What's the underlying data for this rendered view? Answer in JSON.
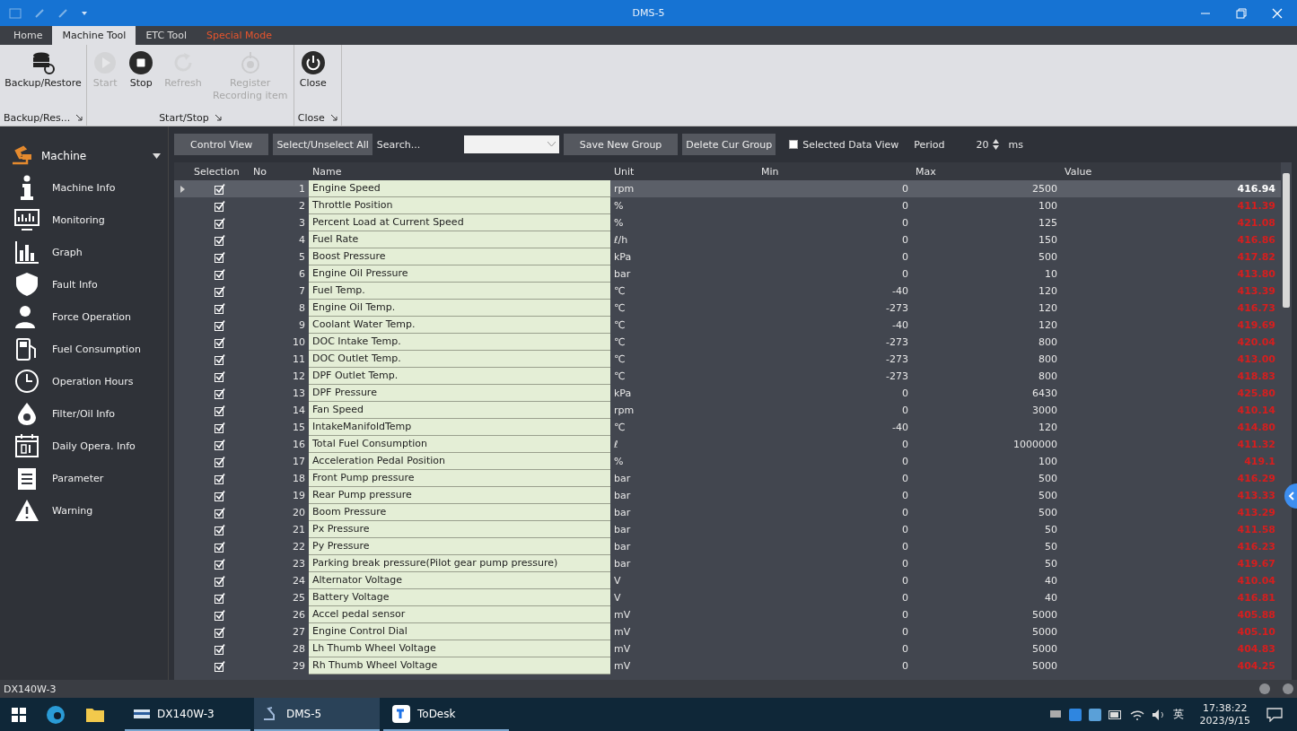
{
  "window": {
    "title": "DMS-5"
  },
  "tabs": [
    {
      "label": "Home",
      "selected": false,
      "kind": "normal"
    },
    {
      "label": "Machine Tool",
      "selected": true,
      "kind": "normal"
    },
    {
      "label": "ETC Tool",
      "selected": false,
      "kind": "normal"
    },
    {
      "label": "Special Mode",
      "selected": false,
      "kind": "special"
    }
  ],
  "ribbon_groups": [
    {
      "name": "Backup/Res...",
      "buttons": [
        {
          "label": "Backup/Restore",
          "disabled": false,
          "kind": "backup"
        }
      ]
    },
    {
      "name": "Start/Stop",
      "buttons": [
        {
          "label": "Start",
          "disabled": true,
          "kind": "start"
        },
        {
          "label": "Stop",
          "disabled": false,
          "kind": "stop"
        },
        {
          "label": "Refresh",
          "disabled": true,
          "kind": "refresh"
        },
        {
          "label": "Register Recording item",
          "disabled": true,
          "kind": "record"
        }
      ]
    },
    {
      "name": "Close",
      "buttons": [
        {
          "label": "Close",
          "disabled": false,
          "kind": "power"
        }
      ]
    }
  ],
  "sidebar": {
    "header": "Machine",
    "items": [
      {
        "label": "Machine Info",
        "kind": "info"
      },
      {
        "label": "Monitoring",
        "kind": "monitor"
      },
      {
        "label": "Graph",
        "kind": "graph"
      },
      {
        "label": "Fault Info",
        "kind": "fault"
      },
      {
        "label": "Force Operation",
        "kind": "person"
      },
      {
        "label": "Fuel Consumption",
        "kind": "fuel"
      },
      {
        "label": "Operation Hours",
        "kind": "clock"
      },
      {
        "label": "Filter/Oil Info",
        "kind": "drop"
      },
      {
        "label": "Daily Opera. Info",
        "kind": "calendar"
      },
      {
        "label": "Parameter",
        "kind": "clipboard"
      },
      {
        "label": "Warning",
        "kind": "warning"
      }
    ]
  },
  "toolbar": {
    "control_view": "Control View",
    "select_all": "Select/Unselect All",
    "search_label": "Search...",
    "save_group": "Save New Group",
    "delete_group": "Delete Cur Group",
    "selected_data_view": {
      "label": "Selected Data View",
      "checked": false
    },
    "period_label": "Period",
    "period_value": "20",
    "period_unit": "ms"
  },
  "table": {
    "columns": [
      "Selection",
      "No",
      "Name",
      "Unit",
      "Min",
      "Max",
      "Value"
    ],
    "rows": [
      {
        "selected": true,
        "checked": true,
        "no": "1",
        "name": "Engine Speed",
        "unit": "rpm",
        "min": "0",
        "max": "2500",
        "value": "416.94"
      },
      {
        "selected": false,
        "checked": true,
        "no": "2",
        "name": "Throttle Position",
        "unit": "%",
        "min": "0",
        "max": "100",
        "value": "411.39"
      },
      {
        "selected": false,
        "checked": true,
        "no": "3",
        "name": "Percent Load at Current Speed",
        "unit": "%",
        "min": "0",
        "max": "125",
        "value": "421.08"
      },
      {
        "selected": false,
        "checked": true,
        "no": "4",
        "name": "Fuel Rate",
        "unit": "ℓ/h",
        "min": "0",
        "max": "150",
        "value": "416.86"
      },
      {
        "selected": false,
        "checked": true,
        "no": "5",
        "name": "Boost Pressure",
        "unit": "kPa",
        "min": "0",
        "max": "500",
        "value": "417.82"
      },
      {
        "selected": false,
        "checked": true,
        "no": "6",
        "name": "Engine Oil Pressure",
        "unit": "bar",
        "min": "0",
        "max": "10",
        "value": "413.80"
      },
      {
        "selected": false,
        "checked": true,
        "no": "7",
        "name": "Fuel Temp.",
        "unit": "℃",
        "min": "-40",
        "max": "120",
        "value": "413.39"
      },
      {
        "selected": false,
        "checked": true,
        "no": "8",
        "name": "Engine Oil Temp.",
        "unit": "℃",
        "min": "-273",
        "max": "120",
        "value": "416.73"
      },
      {
        "selected": false,
        "checked": true,
        "no": "9",
        "name": "Coolant Water Temp.",
        "unit": "℃",
        "min": "-40",
        "max": "120",
        "value": "419.69"
      },
      {
        "selected": false,
        "checked": true,
        "no": "10",
        "name": "DOC Intake Temp.",
        "unit": "℃",
        "min": "-273",
        "max": "800",
        "value": "420.04"
      },
      {
        "selected": false,
        "checked": true,
        "no": "11",
        "name": "DOC Outlet Temp.",
        "unit": "℃",
        "min": "-273",
        "max": "800",
        "value": "413.00"
      },
      {
        "selected": false,
        "checked": true,
        "no": "12",
        "name": "DPF Outlet Temp.",
        "unit": "℃",
        "min": "-273",
        "max": "800",
        "value": "418.83"
      },
      {
        "selected": false,
        "checked": true,
        "no": "13",
        "name": "DPF Pressure",
        "unit": "kPa",
        "min": "0",
        "max": "6430",
        "value": "425.80"
      },
      {
        "selected": false,
        "checked": true,
        "no": "14",
        "name": "Fan Speed",
        "unit": "rpm",
        "min": "0",
        "max": "3000",
        "value": "410.14"
      },
      {
        "selected": false,
        "checked": true,
        "no": "15",
        "name": "IntakeManifoldTemp",
        "unit": "℃",
        "min": "-40",
        "max": "120",
        "value": "414.80"
      },
      {
        "selected": false,
        "checked": true,
        "no": "16",
        "name": "Total Fuel Consumption",
        "unit": "ℓ",
        "min": "0",
        "max": "1000000",
        "value": "411.32"
      },
      {
        "selected": false,
        "checked": true,
        "no": "17",
        "name": "Acceleration Pedal Position",
        "unit": "%",
        "min": "0",
        "max": "100",
        "value": "419.1"
      },
      {
        "selected": false,
        "checked": true,
        "no": "18",
        "name": "Front Pump pressure",
        "unit": "bar",
        "min": "0",
        "max": "500",
        "value": "416.29"
      },
      {
        "selected": false,
        "checked": true,
        "no": "19",
        "name": "Rear Pump pressure",
        "unit": "bar",
        "min": "0",
        "max": "500",
        "value": "413.33"
      },
      {
        "selected": false,
        "checked": true,
        "no": "20",
        "name": "Boom Pressure",
        "unit": "bar",
        "min": "0",
        "max": "500",
        "value": "413.29"
      },
      {
        "selected": false,
        "checked": true,
        "no": "21",
        "name": "Px Pressure",
        "unit": "bar",
        "min": "0",
        "max": "50",
        "value": "411.58"
      },
      {
        "selected": false,
        "checked": true,
        "no": "22",
        "name": "Py Pressure",
        "unit": "bar",
        "min": "0",
        "max": "50",
        "value": "416.23"
      },
      {
        "selected": false,
        "checked": true,
        "no": "23",
        "name": "Parking break pressure(Pilot gear pump pressure)",
        "unit": "bar",
        "min": "0",
        "max": "50",
        "value": "419.67"
      },
      {
        "selected": false,
        "checked": true,
        "no": "24",
        "name": "Alternator Voltage",
        "unit": "V",
        "min": "0",
        "max": "40",
        "value": "410.04"
      },
      {
        "selected": false,
        "checked": true,
        "no": "25",
        "name": "Battery Voltage",
        "unit": "V",
        "min": "0",
        "max": "40",
        "value": "416.81"
      },
      {
        "selected": false,
        "checked": true,
        "no": "26",
        "name": "Accel pedal sensor",
        "unit": "mV",
        "min": "0",
        "max": "5000",
        "value": "405.88"
      },
      {
        "selected": false,
        "checked": true,
        "no": "27",
        "name": "Engine Control Dial",
        "unit": "mV",
        "min": "0",
        "max": "5000",
        "value": "405.10"
      },
      {
        "selected": false,
        "checked": true,
        "no": "28",
        "name": "Lh Thumb Wheel Voltage",
        "unit": "mV",
        "min": "0",
        "max": "5000",
        "value": "404.83"
      },
      {
        "selected": false,
        "checked": true,
        "no": "29",
        "name": "Rh Thumb Wheel Voltage",
        "unit": "mV",
        "min": "0",
        "max": "5000",
        "value": "404.25"
      }
    ]
  },
  "status_bar": {
    "model": "DX140W-3"
  },
  "taskbar": {
    "apps": [
      {
        "label": "DX140W-3",
        "selected": false,
        "kind": "machine"
      },
      {
        "label": "DMS-5",
        "selected": true,
        "kind": "dms"
      },
      {
        "label": "ToDesk",
        "selected": false,
        "kind": "todesk"
      }
    ],
    "ime": "英",
    "time": "17:38:22",
    "date": "2023/9/15"
  }
}
